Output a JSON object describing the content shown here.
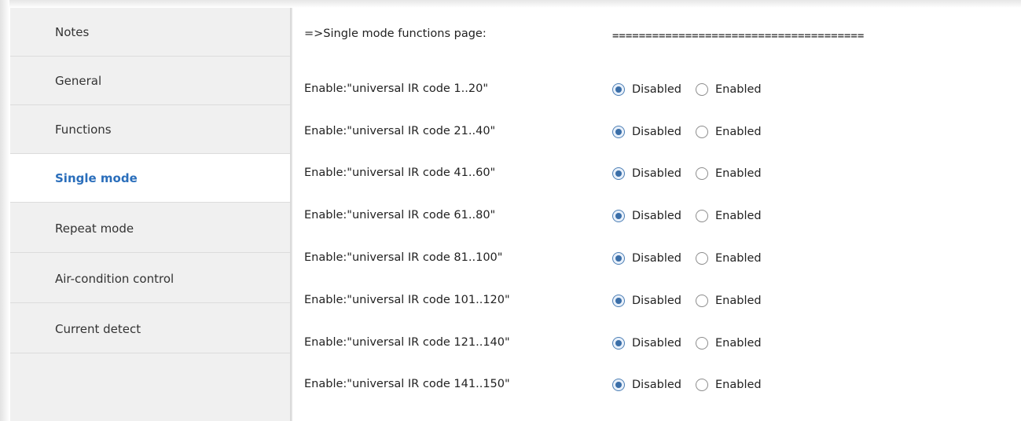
{
  "sidebar": {
    "items": [
      {
        "label": "Notes"
      },
      {
        "label": "General"
      },
      {
        "label": "Functions"
      },
      {
        "label": "Single mode",
        "active": true
      },
      {
        "label": "Repeat mode"
      },
      {
        "label": "Air-condition control"
      },
      {
        "label": "Current detect"
      }
    ]
  },
  "content": {
    "header_label": "=>Single mode functions page:",
    "header_value": "======================================",
    "rows": [
      {
        "label": "Enable:\"universal IR code 1..20\"",
        "selected": "Disabled"
      },
      {
        "label": "Enable:\"universal IR code 21..40\"",
        "selected": "Disabled"
      },
      {
        "label": "Enable:\"universal IR code 41..60\"",
        "selected": "Disabled"
      },
      {
        "label": "Enable:\"universal IR code 61..80\"",
        "selected": "Disabled"
      },
      {
        "label": "Enable:\"universal IR code 81..100\"",
        "selected": "Disabled"
      },
      {
        "label": "Enable:\"universal IR code 101..120\"",
        "selected": "Disabled"
      },
      {
        "label": "Enable:\"universal IR code 121..140\"",
        "selected": "Disabled"
      },
      {
        "label": "Enable:\"universal IR code 141..150\"",
        "selected": "Disabled"
      }
    ],
    "option_disabled": "Disabled",
    "option_enabled": "Enabled"
  },
  "colors": {
    "active_nav": "#2a6ebb",
    "sidebar_bg": "#f0f0f0",
    "radio_checked": "#3a6ea8"
  }
}
